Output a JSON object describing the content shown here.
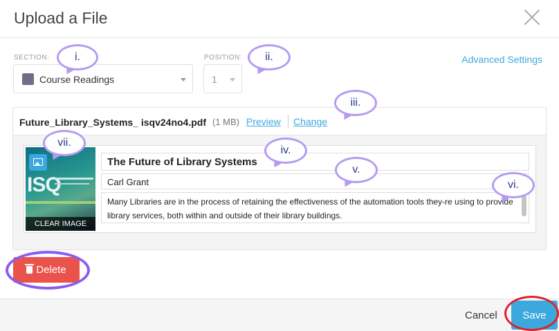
{
  "dialog": {
    "title": "Upload a File"
  },
  "section": {
    "label": "SECTION:",
    "value": "Course Readings",
    "swatch_color": "#6d6f8a"
  },
  "position": {
    "label": "POSITION:",
    "value": "1"
  },
  "advanced_settings_label": "Advanced Settings",
  "file": {
    "name": "Future_Library_Systems_ isqv24no4.pdf",
    "size": "(1 MB)",
    "preview_label": "Preview",
    "change_label": "Change",
    "cover_title": "ISQ",
    "clear_image_label": "CLEAR IMAGE",
    "title": "The Future of Library Systems",
    "author": "Carl Grant",
    "description": "Many Libraries are in the process of retaining the effectiveness of the automation tools they-re using to provide library services, both within and outside of their library buildings."
  },
  "actions": {
    "delete_label": "Delete",
    "cancel_label": "Cancel",
    "save_label": "Save"
  },
  "annotations": [
    "i.",
    "ii.",
    "iii.",
    "iv.",
    "v.",
    "vi.",
    "vii."
  ],
  "colors": {
    "accent": "#3ba8de",
    "danger": "#e9534b",
    "annotation_outline": "#b49bf0",
    "highlight_purple": "#8a5cf0",
    "highlight_red": "#e0202a"
  }
}
